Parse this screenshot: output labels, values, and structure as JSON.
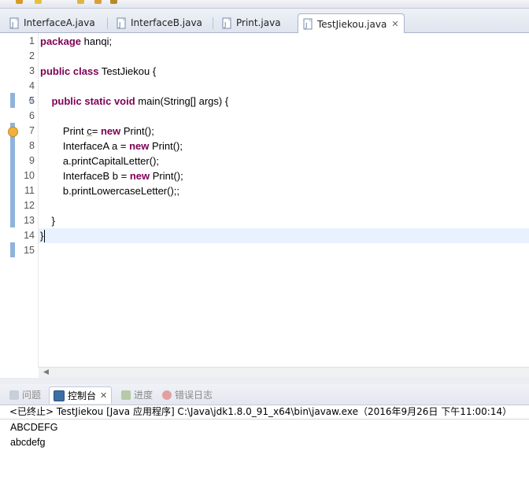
{
  "editor_tabs": [
    {
      "label": "InterfaceA.java",
      "active": false
    },
    {
      "label": "InterfaceB.java",
      "active": false
    },
    {
      "label": "Print.java",
      "active": false
    },
    {
      "label": "TestJiekou.java",
      "active": true,
      "close": "✕"
    }
  ],
  "editor": {
    "line_numbers": [
      "1",
      "2",
      "3",
      "4",
      "5",
      "6",
      "7",
      "8",
      "9",
      "10",
      "11",
      "12",
      "13",
      "14",
      "15"
    ],
    "current_line": 14,
    "lines": [
      [
        {
          "t": "package",
          "k": 1
        },
        {
          "t": " hanqi;"
        }
      ],
      [],
      [
        {
          "t": "public",
          "k": 1
        },
        {
          "t": " "
        },
        {
          "t": "class",
          "k": 1
        },
        {
          "t": " TestJiekou {"
        }
      ],
      [],
      [
        {
          "t": "    "
        },
        {
          "t": "public",
          "k": 1
        },
        {
          "t": " "
        },
        {
          "t": "static",
          "k": 1
        },
        {
          "t": " "
        },
        {
          "t": "void",
          "k": 1
        },
        {
          "t": " main(String[] args) {"
        }
      ],
      [],
      [
        {
          "t": "        Print "
        },
        {
          "t": "c",
          "u": 1
        },
        {
          "t": "= "
        },
        {
          "t": "new",
          "k": 1
        },
        {
          "t": " Print();"
        }
      ],
      [
        {
          "t": "        InterfaceA a = "
        },
        {
          "t": "new",
          "k": 1
        },
        {
          "t": " Print();"
        }
      ],
      [
        {
          "t": "        a.printCapitalLetter();"
        }
      ],
      [
        {
          "t": "        InterfaceB b = "
        },
        {
          "t": "new",
          "k": 1
        },
        {
          "t": " Print();"
        }
      ],
      [
        {
          "t": "        b.printLowercaseLetter();;"
        }
      ],
      [],
      [
        {
          "t": "    }"
        }
      ],
      [
        {
          "t": "}"
        }
      ],
      []
    ]
  },
  "panel": {
    "tabs": [
      {
        "label": "问题",
        "active": false,
        "icon": "problems-icon"
      },
      {
        "label": "控制台",
        "active": true,
        "icon": "console-icon",
        "close": "✕"
      },
      {
        "label": "进度",
        "active": false,
        "icon": "progress-icon"
      },
      {
        "label": "错误日志",
        "active": false,
        "icon": "error-log-icon"
      }
    ],
    "console_header": "<已终止> TestJiekou [Java 应用程序] C:\\Java\\jdk1.8.0_91_x64\\bin\\javaw.exe（2016年9月26日 下午11:00:14）",
    "output": [
      "ABCDEFG",
      "abcdefg"
    ]
  },
  "colors": {
    "keyword": "#7f0055",
    "current_line": "#e8f2fe",
    "change_bar": "#8fb3db"
  }
}
